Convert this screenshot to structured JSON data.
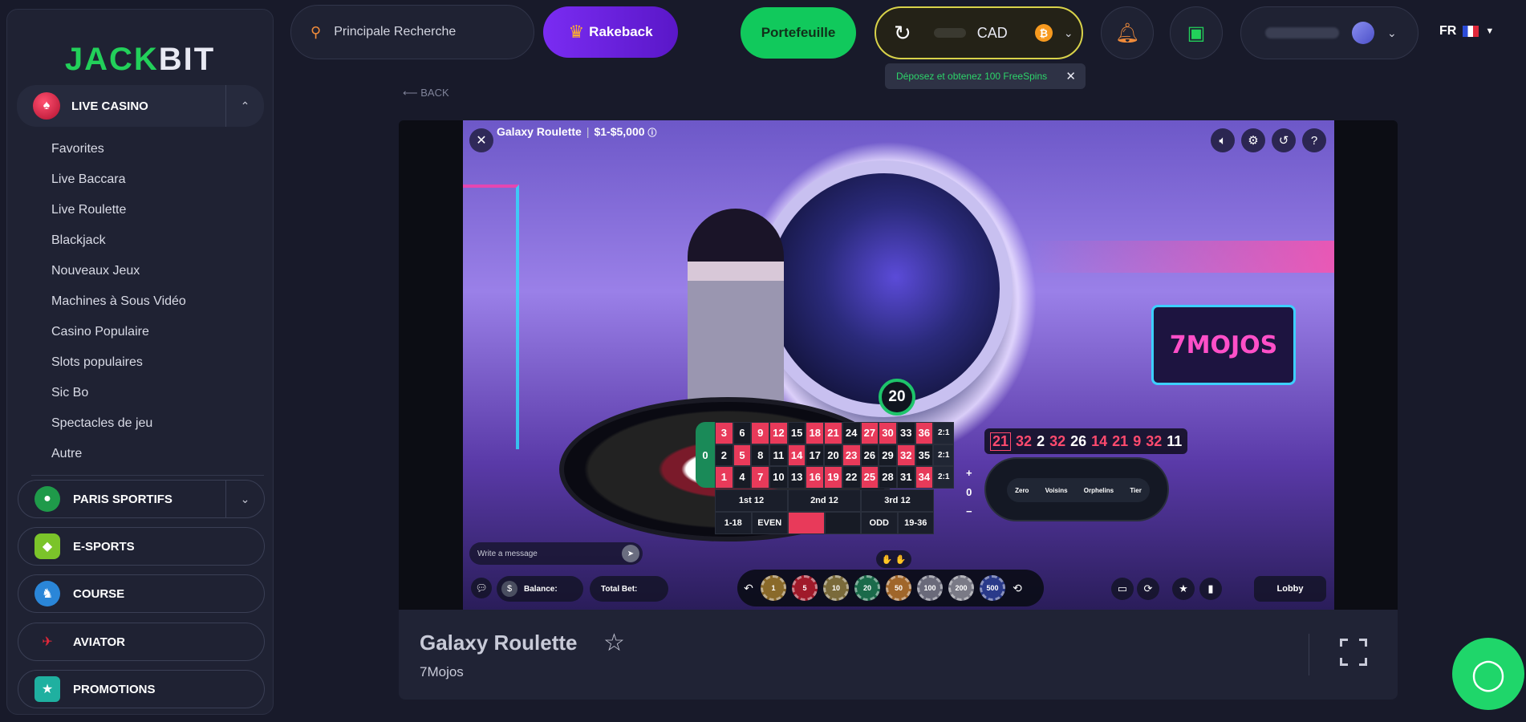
{
  "sidebar": {
    "logo_left": "JACK",
    "logo_right": "BIT",
    "live_casino": "LIVE CASINO",
    "sub_items": [
      "Favorites",
      "Live Baccara",
      "Live Roulette",
      "Blackjack",
      "Nouveaux Jeux",
      "Machines à Sous Vidéo",
      "Casino Populaire",
      "Slots populaires",
      "Sic Bo",
      "Spectacles de jeu",
      "Autre"
    ],
    "sports": "PARIS SPORTIFS",
    "esports": "E-SPORTS",
    "course": "COURSE",
    "aviator": "AVIATOR",
    "promotions": "PROMOTIONS"
  },
  "header": {
    "search_placeholder": "Principale Recherche",
    "rakeback": "Rakeback",
    "wallet": "Portefeuille",
    "currency": "CAD",
    "btc_symbol": "₿",
    "tooltip": "Déposez et obtenez 100 FreeSpins",
    "lang": "FR"
  },
  "back": "BACK",
  "game": {
    "title": "Galaxy Roulette",
    "limits": "$1-$5,000",
    "timer": "20",
    "studio_logo": "7MOJOS",
    "chat_placeholder": "Write a message",
    "balance_label": "Balance:",
    "total_bet_label": "Total Bet:",
    "lobby": "Lobby",
    "zero": "0",
    "rows": [
      [
        "3",
        "6",
        "9",
        "12",
        "15",
        "18",
        "21",
        "24",
        "27",
        "30",
        "33",
        "36",
        "2:1"
      ],
      [
        "2",
        "5",
        "8",
        "11",
        "14",
        "17",
        "20",
        "23",
        "26",
        "29",
        "32",
        "35",
        "2:1"
      ],
      [
        "1",
        "4",
        "7",
        "10",
        "13",
        "16",
        "19",
        "22",
        "25",
        "28",
        "31",
        "34",
        "2:1"
      ]
    ],
    "red_numbers": [
      "1",
      "3",
      "5",
      "7",
      "9",
      "12",
      "14",
      "16",
      "18",
      "19",
      "21",
      "23",
      "25",
      "27",
      "30",
      "32",
      "34",
      "36"
    ],
    "dozens": [
      "1st 12",
      "2nd 12",
      "3rd 12"
    ],
    "evens": [
      "1-18",
      "EVEN",
      "",
      "",
      "ODD",
      "19-36"
    ],
    "history": [
      "21",
      "32",
      "2",
      "32",
      "26",
      "14",
      "21",
      "9",
      "32",
      "11"
    ],
    "racetrack_sections": [
      "Zero",
      "Voisins",
      "Orphelins",
      "Tier"
    ],
    "chips": [
      "1",
      "5",
      "10",
      "20",
      "50",
      "100",
      "200",
      "500"
    ],
    "race_plus": "+",
    "race_zero": "0",
    "race_minus": "−"
  },
  "info": {
    "name": "Galaxy Roulette",
    "provider": "7Mojos"
  },
  "colors": {
    "accent_green": "#11c95c",
    "rakeback_purple": "#7a2cf2",
    "roulette_red": "#e83a5a"
  }
}
